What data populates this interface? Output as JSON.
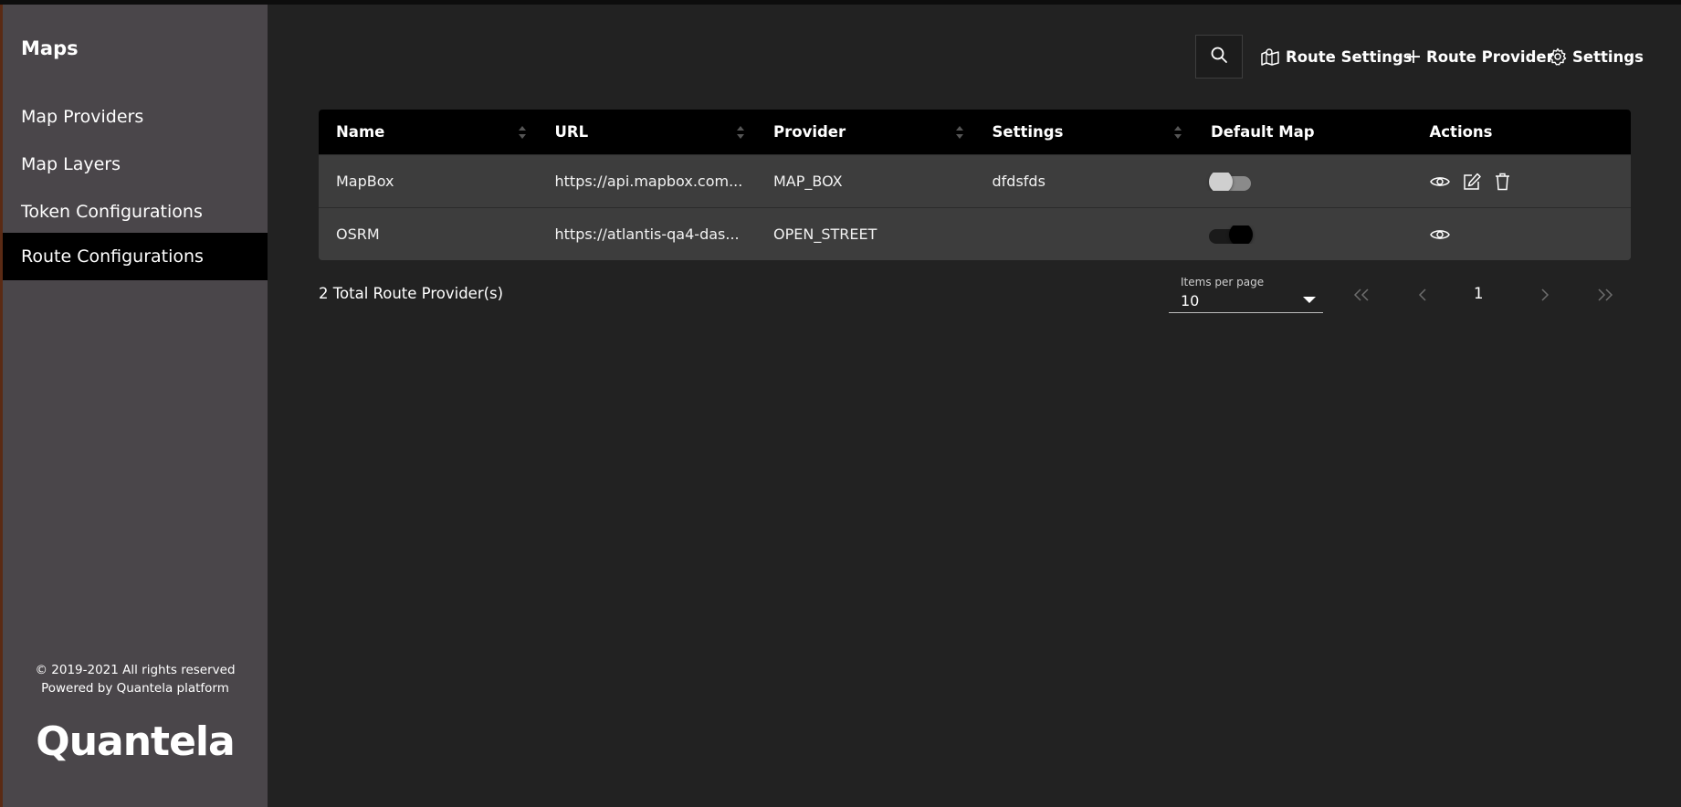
{
  "sidebar": {
    "title": "Maps",
    "items": [
      {
        "label": "Map Providers"
      },
      {
        "label": "Map Layers"
      },
      {
        "label": "Token Configurations"
      },
      {
        "label": "Route Configurations",
        "active": true
      }
    ],
    "copyright_line1": "© 2019-2021 All rights reserved",
    "copyright_line2": "Powered by Quantela platform",
    "logo_text": "Quantela"
  },
  "toolbar": {
    "search_icon": "search-icon",
    "route_settings_label": "Route Settings",
    "route_provider_label": "Route Provider",
    "settings_label": "Settings"
  },
  "table": {
    "columns": [
      "Name",
      "URL",
      "Provider",
      "Settings",
      "Default Map",
      "Actions"
    ],
    "rows": [
      {
        "name": "MapBox",
        "url": "https://api.mapbox.com...",
        "provider": "MAP_BOX",
        "settings": "dfdsfds",
        "default_map": false,
        "actions": [
          "view-icon",
          "edit-icon",
          "delete-icon"
        ]
      },
      {
        "name": "OSRM",
        "url": "https://atlantis-qa4-das...",
        "provider": "OPEN_STREET",
        "settings": "",
        "default_map": true,
        "actions": [
          "view-icon"
        ]
      }
    ]
  },
  "footer": {
    "total": "2 Total Route Provider(s)",
    "items_per_page_label": "Items per page",
    "items_per_page_value": "10",
    "page": "1"
  },
  "colors": {
    "background": "#222222",
    "sidebar": "#4a464a",
    "active_nav": "#000000",
    "table_header": "#000000",
    "table_row": "#3d3d3d"
  }
}
